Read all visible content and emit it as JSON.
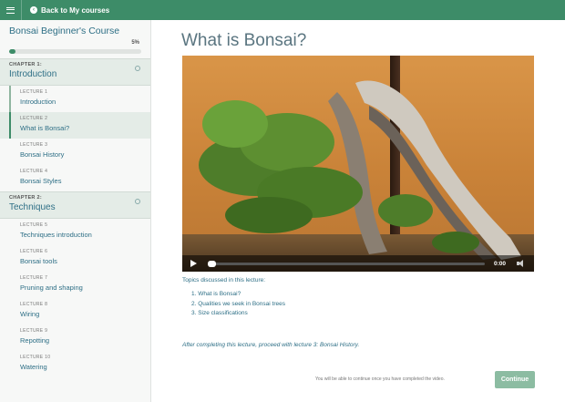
{
  "topbar": {
    "menu_icon": "hamburger-menu-icon",
    "back_icon": "arrow-left-circle-icon",
    "back_label": "Back to My courses",
    "accent_color": "#3d8c68"
  },
  "sidebar": {
    "course_title": "Bonsai Beginner's Course",
    "progress_label": "5%",
    "progress_value": 0.05,
    "chapters": [
      {
        "kicker": "CHAPTER 1:",
        "name": "Introduction",
        "lectures": [
          {
            "kicker": "LECTURE 1",
            "name": "Introduction"
          },
          {
            "kicker": "LECTURE 2",
            "name": "What is Bonsai?"
          },
          {
            "kicker": "LECTURE 3",
            "name": "Bonsai History"
          },
          {
            "kicker": "LECTURE 4",
            "name": "Bonsai Styles"
          }
        ]
      },
      {
        "kicker": "CHAPTER 2:",
        "name": "Techniques",
        "lectures": [
          {
            "kicker": "LECTURE 5",
            "name": "Techniques introduction"
          },
          {
            "kicker": "LECTURE 6",
            "name": "Bonsai tools"
          },
          {
            "kicker": "LECTURE 7",
            "name": "Pruning and shaping"
          },
          {
            "kicker": "LECTURE 8",
            "name": "Wiring"
          },
          {
            "kicker": "LECTURE 9",
            "name": "Repotting"
          },
          {
            "kicker": "LECTURE 10",
            "name": "Watering"
          }
        ]
      }
    ]
  },
  "main": {
    "lecture_title": "What is Bonsai?",
    "video": {
      "timecode": "0:00",
      "play_icon": "play-icon",
      "volume_icon": "volume-icon"
    },
    "topics_intro": "Topics discussed in this lecture:",
    "topics": [
      "1.  What is Bonsai?",
      "2.  Qualities we seek in Bonsai trees",
      "3.  Size classifications"
    ],
    "after_note": "After completing this lecture, proceed with lecture 3: Bonsai History.",
    "continue_note": "You will be able to continue once you have completed the video.",
    "continue_label": "Continue"
  }
}
